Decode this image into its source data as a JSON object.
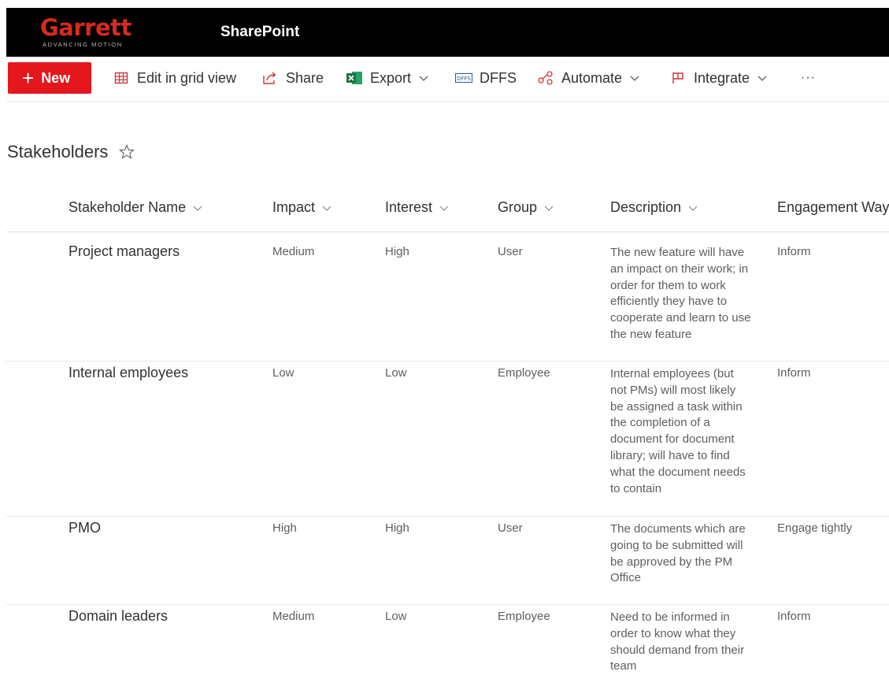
{
  "brand": {
    "logo_text": "Garrett",
    "logo_subtext": "ADVANCING MOTION",
    "app_name": "SharePoint"
  },
  "commands": {
    "new": "New",
    "edit_grid": "Edit in grid view",
    "share": "Share",
    "export": "Export",
    "dffs": "DFFS",
    "automate": "Automate",
    "integrate": "Integrate",
    "more": "···"
  },
  "list": {
    "title": "Stakeholders",
    "columns": [
      "Stakeholder Name",
      "Impact",
      "Interest",
      "Group",
      "Description",
      "Engagement Way"
    ],
    "rows": [
      {
        "name": "Project managers",
        "impact": "Medium",
        "interest": "High",
        "group": "User",
        "description": [
          "The new feature will have",
          "an impact on their work; in",
          "order for them to work",
          "efficiently they have to",
          "cooperate and learn to use",
          "the new feature"
        ],
        "engagement": "Inform"
      },
      {
        "name": "Internal employees",
        "impact": "Low",
        "interest": "Low",
        "group": "Employee",
        "description": [
          "Internal employees (but",
          "not PMs) will most likely",
          "be assigned a task within",
          "the completion of a",
          "document for document",
          "library; will have to find",
          "what the document needs",
          "to contain"
        ],
        "engagement": "Inform"
      },
      {
        "name": "PMO",
        "impact": "High",
        "interest": "High",
        "group": "User",
        "description": [
          "The documents which are",
          "going to be submitted will",
          "be approved by the PM",
          "Office"
        ],
        "engagement": "Engage tightly"
      },
      {
        "name": "Domain leaders",
        "impact": "Medium",
        "interest": "Low",
        "group": "Employee",
        "description": [
          "Need to be informed in",
          "order to know what they",
          "should demand from their",
          "team"
        ],
        "engagement": "Inform"
      }
    ]
  },
  "icons": {
    "new": "plus-icon",
    "edit_grid": "grid-icon",
    "share": "share-icon",
    "export": "excel-icon",
    "dffs": "dffs-icon",
    "automate": "flow-icon",
    "integrate": "integrate-icon",
    "favorite": "star-icon",
    "sort": "chevron-down-icon"
  },
  "colors": {
    "brand_red": "#d52b1e",
    "new_button": "#e4161e",
    "suite_bar": "#000000",
    "icon_red": "#d13438",
    "excel_green": "#1d6f42"
  }
}
